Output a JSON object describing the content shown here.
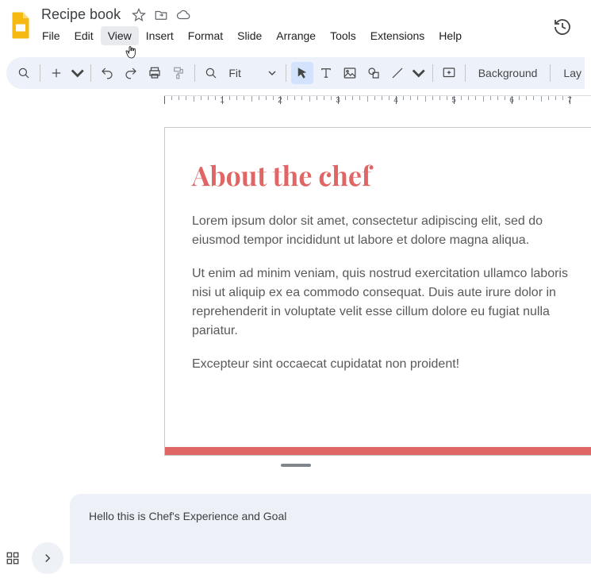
{
  "doc": {
    "title": "Recipe book"
  },
  "menus": {
    "file": "File",
    "edit": "Edit",
    "view": "View",
    "insert": "Insert",
    "format": "Format",
    "slide": "Slide",
    "arrange": "Arrange",
    "tools": "Tools",
    "extensions": "Extensions",
    "help": "Help"
  },
  "menu_hover": "view",
  "toolbar": {
    "zoom_label": "Fit",
    "background_label": "Background",
    "layout_label": "Lay"
  },
  "ruler": {
    "labels": [
      "1",
      "2",
      "3",
      "4",
      "5",
      "6",
      "7"
    ]
  },
  "slide": {
    "title": "About the chef",
    "p1": "Lorem ipsum dolor sit amet, consectetur adipiscing elit, sed do eiusmod tempor incididunt ut labore et dolore magna aliqua.",
    "p2": "Ut enim ad minim veniam, quis nostrud exercitation ullamco laboris nisi ut aliquip ex ea commodo consequat. Duis aute irure dolor in reprehenderit in voluptate velit esse cillum dolore eu fugiat nulla pariatur.",
    "p3": "Excepteur sint occaecat cupidatat non proident!"
  },
  "notes": {
    "text": "Hello this is Chef's Experience and Goal"
  }
}
